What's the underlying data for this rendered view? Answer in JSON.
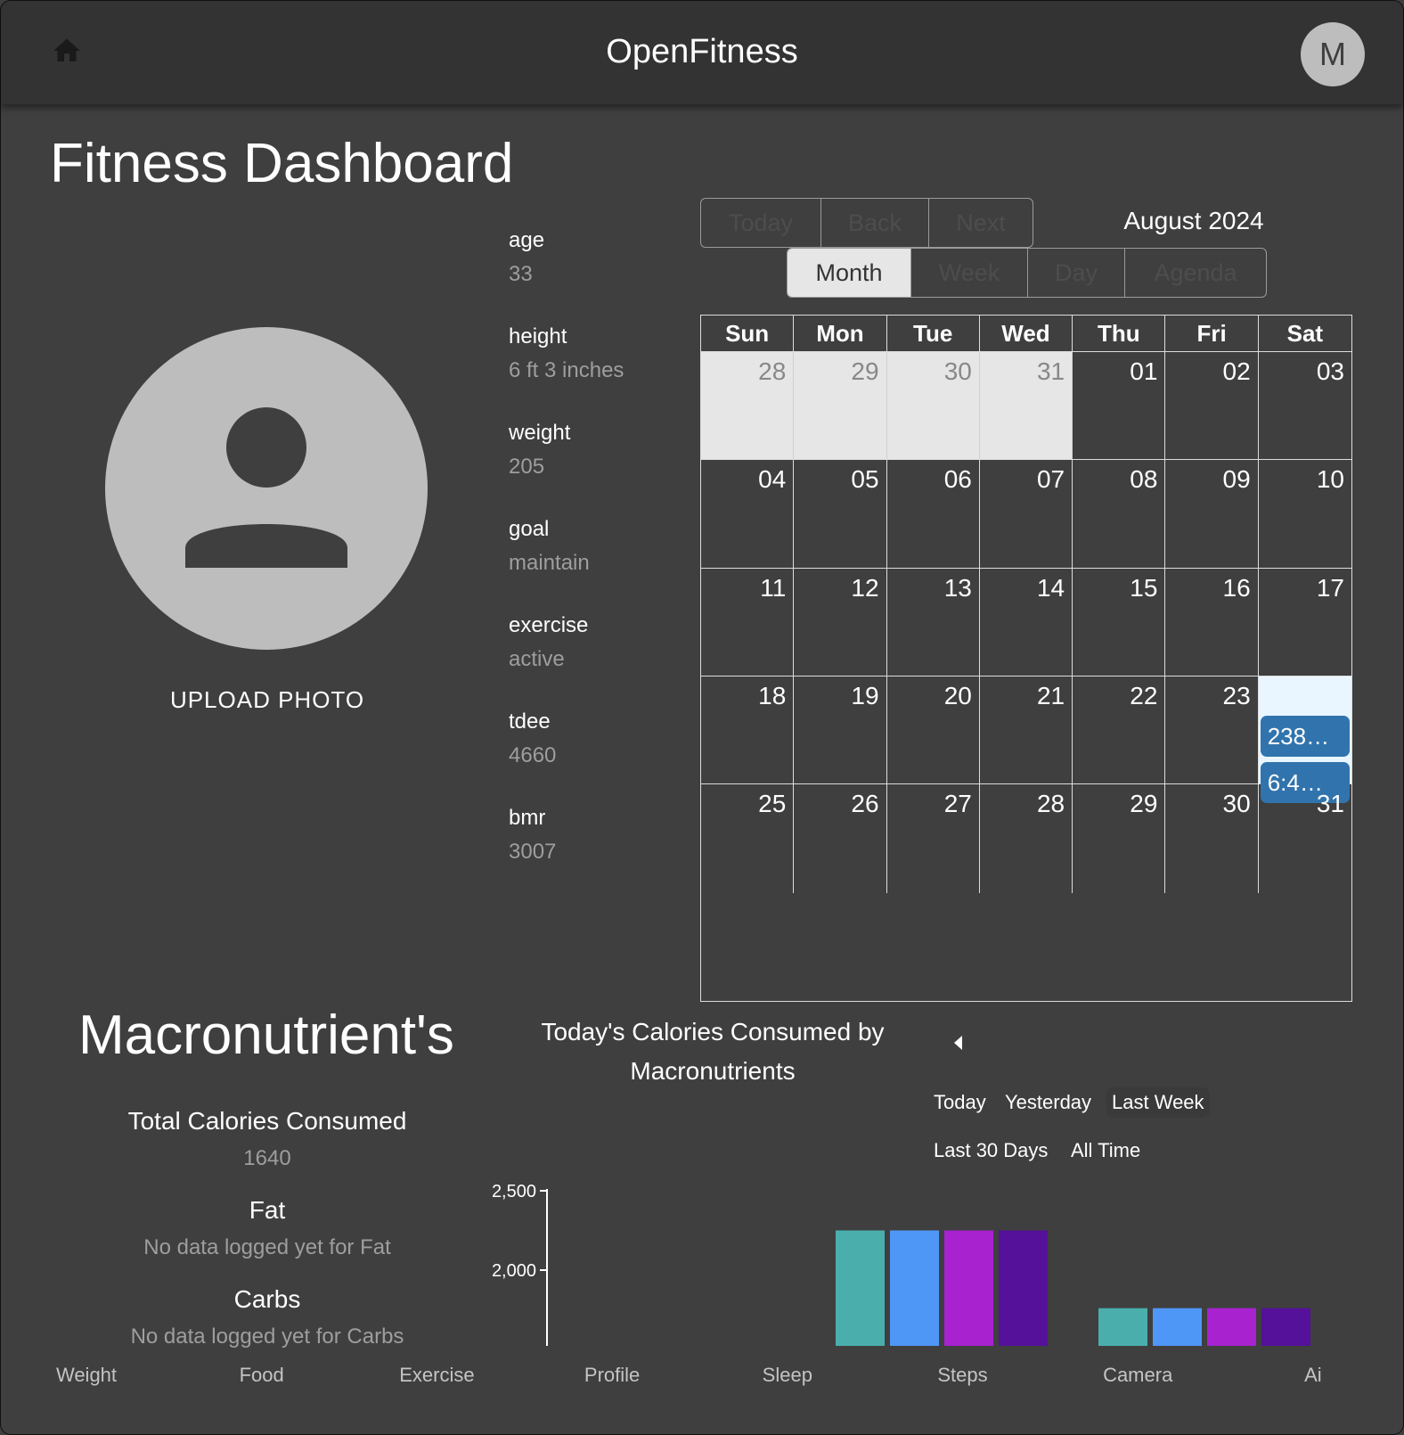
{
  "header": {
    "title": "OpenFitness",
    "avatar_letter": "M",
    "home_icon": "home-icon"
  },
  "page_title": "Fitness Dashboard",
  "profile": {
    "upload_label": "UPLOAD PHOTO",
    "stats": [
      {
        "label": "age",
        "value": "33"
      },
      {
        "label": "height",
        "value": "6 ft 3 inches"
      },
      {
        "label": "weight",
        "value": "205"
      },
      {
        "label": "goal",
        "value": "maintain"
      },
      {
        "label": "exercise",
        "value": "active"
      },
      {
        "label": "tdee",
        "value": "4660"
      },
      {
        "label": "bmr",
        "value": "3007"
      }
    ]
  },
  "calendar": {
    "nav_buttons": [
      "Today",
      "Back",
      "Next"
    ],
    "view_buttons": [
      "Month",
      "Week",
      "Day",
      "Agenda"
    ],
    "active_view": "Month",
    "label": "August 2024",
    "weekdays": [
      "Sun",
      "Mon",
      "Tue",
      "Wed",
      "Thu",
      "Fri",
      "Sat"
    ],
    "days": [
      "28",
      "29",
      "30",
      "31",
      "01",
      "02",
      "03",
      "04",
      "05",
      "06",
      "07",
      "08",
      "09",
      "10",
      "11",
      "12",
      "13",
      "14",
      "15",
      "16",
      "17",
      "18",
      "19",
      "20",
      "21",
      "22",
      "23",
      "",
      "25",
      "26",
      "27",
      "28",
      "29",
      "30",
      "31"
    ],
    "off_range_days": [
      0,
      1,
      2,
      3
    ],
    "today_index": 27,
    "events": [
      "238…",
      "6:4…"
    ]
  },
  "macros": {
    "title": "Macronutrient's",
    "items": [
      {
        "label": "Total Calories Consumed",
        "value": "1640"
      },
      {
        "label": "Fat",
        "value": "No data logged yet for Fat"
      },
      {
        "label": "Carbs",
        "value": "No data logged yet for Carbs"
      }
    ],
    "chart_title": "Today's Calories Consumed by Macronutrients",
    "range_buttons": [
      "Today",
      "Yesterday",
      "Last Week",
      "Last 30 Days",
      "All Time"
    ],
    "selected_range": "Last Week"
  },
  "colors": {
    "series": [
      "#4aafac",
      "#4f97f7",
      "#a822cf",
      "#55119a"
    ],
    "background": "#3f3f3f",
    "appbar": "#333333",
    "event": "#3174ad"
  },
  "chart_data": {
    "type": "bar",
    "yticks": [
      "2,500",
      "2,000"
    ],
    "ylim": [
      1600,
      2500
    ],
    "groups": [
      {
        "values": [
          2250,
          2250,
          2250,
          2250
        ]
      },
      {
        "values": [
          1760,
          1760,
          1760,
          1760
        ]
      }
    ]
  },
  "bottom_nav": [
    "Weight",
    "Food",
    "Exercise",
    "Profile",
    "Sleep",
    "Steps",
    "Camera",
    "Ai"
  ]
}
